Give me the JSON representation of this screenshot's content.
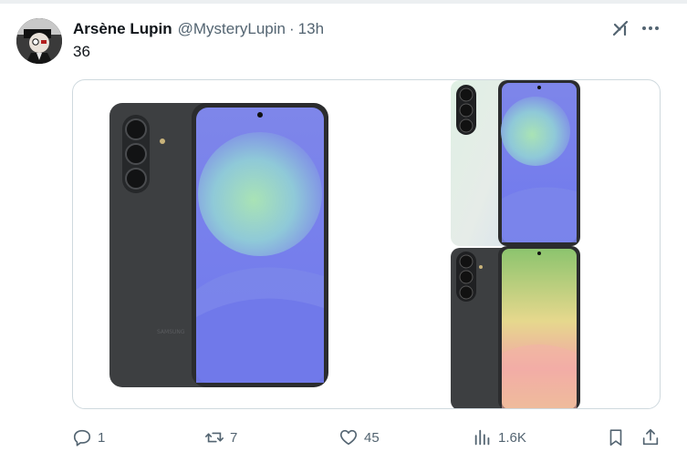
{
  "tweet": {
    "display_name": "Arsène Lupin",
    "handle": "@MysteryLupin",
    "separator": "·",
    "time": "13h",
    "text": "36"
  },
  "media": {
    "brand_text": "SAMSUNG"
  },
  "actions": {
    "replies": "1",
    "reposts": "7",
    "likes": "45",
    "views": "1.6K"
  },
  "icons": {
    "more": "more-icon",
    "grok": "grok-icon",
    "reply": "reply-icon",
    "repost": "repost-icon",
    "like": "heart-icon",
    "views": "analytics-icon",
    "bookmark": "bookmark-icon",
    "share": "share-icon"
  },
  "colors": {
    "text_primary": "#0f1419",
    "text_secondary": "#536471",
    "border": "#cfd9de"
  }
}
